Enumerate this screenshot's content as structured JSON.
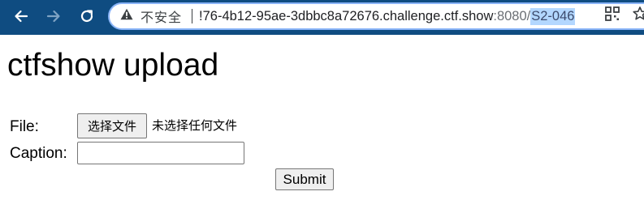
{
  "browser": {
    "security_label": "不安全",
    "url_main": "!76-4b12-95ae-3dbbc8a72676.challenge.ctf.show",
    "url_port": ":8080/",
    "url_path": "S2-046",
    "colors": {
      "toolbar": "#0f4c81",
      "omnibox_border": "#8ab4f8",
      "selection": "#b3d7ff"
    },
    "icons": [
      "back-arrow-icon",
      "forward-arrow-icon",
      "reload-icon",
      "warning-icon",
      "qr-code-icon",
      "star-icon"
    ]
  },
  "page": {
    "title": "ctfshow upload",
    "form": {
      "file_label": "File:",
      "file_button_label": "选择文件",
      "file_status": "未选择任何文件",
      "caption_label": "Caption:",
      "caption_value": "",
      "submit_label": "Submit"
    }
  }
}
